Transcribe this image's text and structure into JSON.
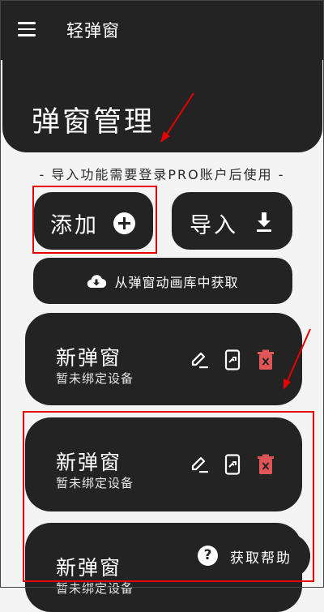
{
  "app": {
    "title": "轻弹窗"
  },
  "header": {
    "page_title": "弹窗管理"
  },
  "notice": "- 导入功能需要登录PRO账户后使用 -",
  "actions": {
    "add_label": "添加",
    "import_label": "导入",
    "library_label": "从弹窗动画库中获取"
  },
  "cards": [
    {
      "title": "新弹窗",
      "subtitle": "暂未绑定设备"
    },
    {
      "title": "新弹窗",
      "subtitle": "暂未绑定设备"
    },
    {
      "title": "新弹窗",
      "subtitle": "暂未绑定设备"
    }
  ],
  "help": {
    "label": "获取帮助"
  },
  "icons": {
    "menu": "menu-icon",
    "add": "plus-circle-icon",
    "import": "download-icon",
    "library": "cloud-download-icon",
    "edit": "pencil-icon",
    "bind": "phone-icon",
    "delete": "trash-icon",
    "help": "help-circle-icon"
  },
  "colors": {
    "surface": "#232323",
    "background": "#f4f4f4",
    "delete": "#e05555",
    "annotation": "#e60000"
  }
}
